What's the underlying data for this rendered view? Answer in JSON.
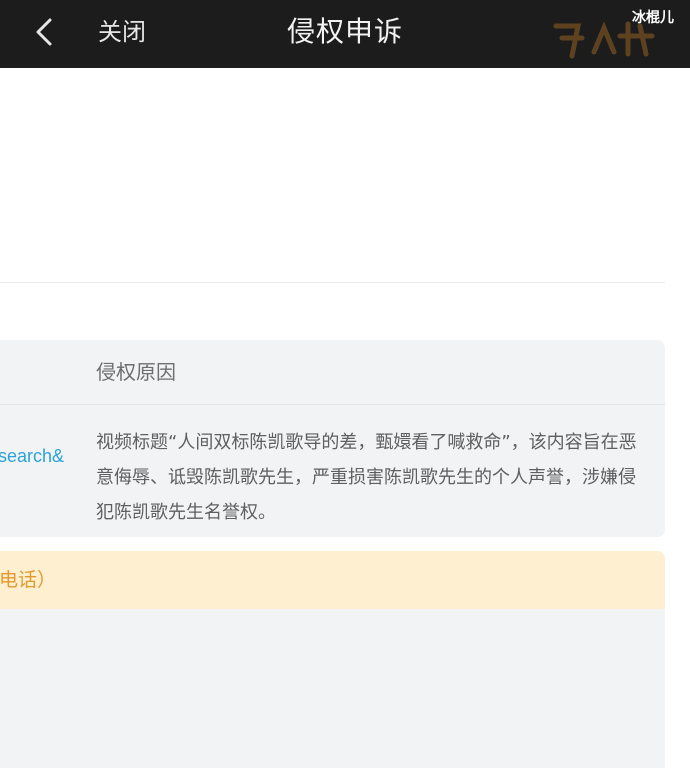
{
  "header": {
    "close_label": "关闭",
    "title": "侵权申诉",
    "watermark_text": "冰棍儿",
    "back_icon": "chevron-left-icon"
  },
  "complaint": {
    "reason_label": "侵权原因",
    "link_fragment": "search&",
    "reason_text": "视频标题“人间双标陈凯歌导的差，甄嬛看了喊救命”，该内容旨在恶意侮辱、诋毁陈凯歌先生，严重损害陈凯歌先生的个人声誉，涉嫌侵犯陈凯歌先生名誉权。"
  },
  "notice": {
    "text": "电话）"
  },
  "colors": {
    "header_bg": "#1c1c1c",
    "card_bg": "#f2f3f5",
    "notice_bg": "#fdefd0",
    "notice_text": "#e39a2d",
    "link": "#2aa3d8"
  }
}
